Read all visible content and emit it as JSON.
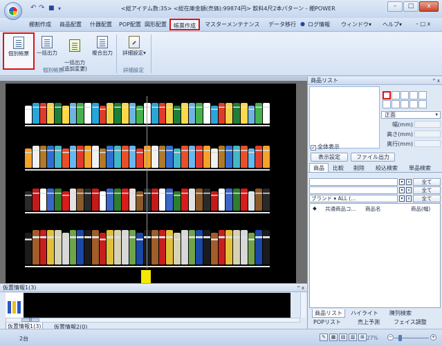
{
  "window": {
    "title": "<総アイテム数:35> <総在庫金額(売価):99874円> 飲料4尺2本パターン - 棚POWER",
    "controls": {
      "minimize": "–",
      "maximize": "□",
      "close": "x"
    }
  },
  "quick_access": {
    "undo": "↶",
    "redo": "↷",
    "save": "■",
    "more": "▾"
  },
  "menu": {
    "items": [
      "棚割作成",
      "商品配置",
      "什器配置",
      "POP配置",
      "図形配置",
      "帳票作成",
      "マスターメンテナンス",
      "データ移行",
      "ログ情報",
      "ウィンドウ▾",
      "ヘルプ▾"
    ],
    "selected": "帳票作成",
    "window_controls": "– □ x"
  },
  "ribbon": {
    "buttons": [
      {
        "label": "個別帳票"
      },
      {
        "label": "一括出力"
      },
      {
        "label": "一括出力\n(追加変更)"
      },
      {
        "label": "複合出力"
      },
      {
        "label": "詳細設定▾"
      }
    ],
    "groups": [
      "個別帳票",
      "詳細設定"
    ]
  },
  "product_panel": {
    "title": "商品リスト",
    "pin": "ꟸ x",
    "face_options_selected": "正面",
    "dims": [
      {
        "label": "幅(mm)"
      },
      {
        "label": "高さ(mm)"
      },
      {
        "label": "奥行(mm)"
      }
    ],
    "show_all_label": "全体表示",
    "show_all_checked": "✓",
    "display_settings_button": "表示設定",
    "file_output_button": "ファイル出力",
    "tabs": [
      "商品",
      "比較",
      "削除",
      "絞込検索",
      "単品検索"
    ],
    "filters": [
      {
        "value": "",
        "all": "全て"
      },
      {
        "value": "",
        "all": "全て"
      },
      {
        "value": "ブランド ▾       ALL (...",
        "all": "全て"
      }
    ],
    "list_headers": [
      "◆",
      "共通商品コ...",
      "商品名",
      "商品(幅)"
    ],
    "bottom_tabs": [
      "商品リスト",
      "ハイライト",
      "陳列検索",
      "POPリスト",
      "売上予測",
      "フェイス調整"
    ]
  },
  "bottom_panel": {
    "title": "仮置情報1(3)",
    "pin": "ꟸ x",
    "tabs": [
      "仮置情報1(3)",
      "仮置情報2(0)"
    ],
    "scroll_thumb": "|||"
  },
  "status": {
    "count": "2台",
    "zoom": "27%",
    "zoom_minus": "−",
    "zoom_plus": "+"
  },
  "colors": {
    "highlight": "#e01010",
    "canvas_bg": "#000000",
    "marker": "#f5e800"
  }
}
